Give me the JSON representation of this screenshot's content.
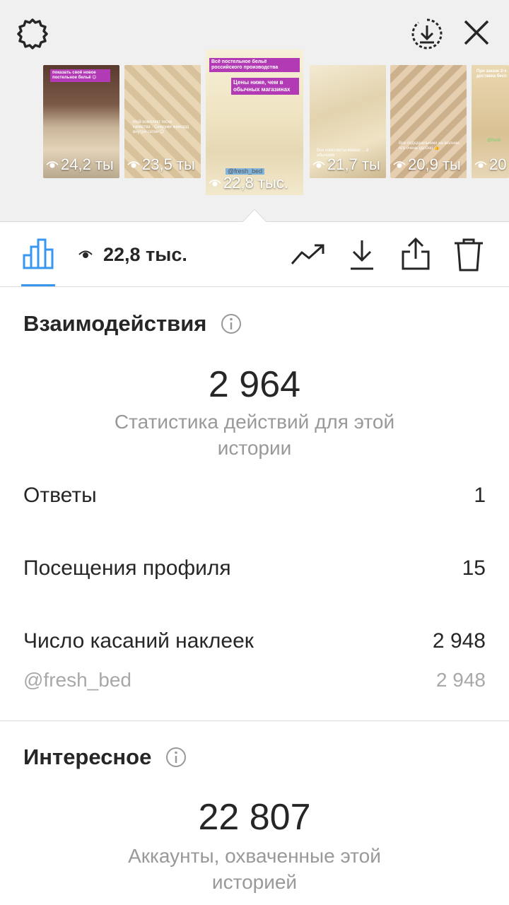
{
  "header": {
    "settings_icon": "gear-icon",
    "download_icon": "download-circle-icon",
    "close_icon": "close-icon"
  },
  "thumbnails": [
    {
      "views": "24,2 ты",
      "sticker": "показать своё новое постельное бельё 😊",
      "caption": ""
    },
    {
      "views": "23,5 ты",
      "sticker": "",
      "caption": "Мой комплект гесхе качества · Снаружи жаккард внутри сатин 😊"
    },
    {
      "views": "22,8 тыс.",
      "sticker": "Всё постельное бельё российского производства",
      "sticker2": "Цены ниже, чем в обычных магазинах",
      "caption": "@fresh_bed",
      "active": true
    },
    {
      "views": "21,7 ты",
      "sticker": "",
      "caption": "Все комплекты можно ... в обычном"
    },
    {
      "views": "20,9 ты",
      "sticker": "",
      "caption": "Все пододеяльники на молнии, что очень удобно 👍"
    },
    {
      "views": "20",
      "sticker": "При заказе 2-х доставка бесп",
      "caption": "@fresh"
    }
  ],
  "toolbar": {
    "views": "22,8 тыс.",
    "icons": [
      "bar-chart-icon",
      "eye-icon",
      "trend-icon",
      "download-icon",
      "share-icon",
      "trash-icon"
    ]
  },
  "interactions": {
    "title": "Взаимодействия",
    "total": "2 964",
    "subtitle": "Статистика действий для этой истории",
    "rows": [
      {
        "label": "Ответы",
        "value": "1"
      },
      {
        "label": "Посещения профиля",
        "value": "15"
      },
      {
        "label": "Число касаний наклеек",
        "value": "2 948"
      }
    ],
    "sub_row": {
      "label": "@fresh_bed",
      "value": "2 948"
    }
  },
  "discovery": {
    "title": "Интересное",
    "total": "22 807",
    "subtitle": "Аккаунты, охваченные этой историей"
  },
  "colors": {
    "accent": "#3897f0",
    "sticker": "#b23ab5",
    "text": "#262626",
    "muted": "#999999"
  }
}
